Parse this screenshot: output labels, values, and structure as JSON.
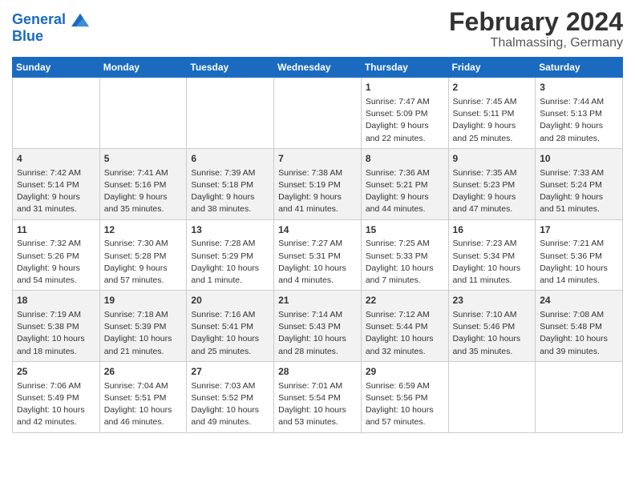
{
  "header": {
    "logo_line1": "General",
    "logo_line2": "Blue",
    "title": "February 2024",
    "subtitle": "Thalmassing, Germany"
  },
  "calendar": {
    "days_of_week": [
      "Sunday",
      "Monday",
      "Tuesday",
      "Wednesday",
      "Thursday",
      "Friday",
      "Saturday"
    ],
    "weeks": [
      [
        {
          "day": "",
          "info": ""
        },
        {
          "day": "",
          "info": ""
        },
        {
          "day": "",
          "info": ""
        },
        {
          "day": "",
          "info": ""
        },
        {
          "day": "1",
          "info": "Sunrise: 7:47 AM\nSunset: 5:09 PM\nDaylight: 9 hours\nand 22 minutes."
        },
        {
          "day": "2",
          "info": "Sunrise: 7:45 AM\nSunset: 5:11 PM\nDaylight: 9 hours\nand 25 minutes."
        },
        {
          "day": "3",
          "info": "Sunrise: 7:44 AM\nSunset: 5:13 PM\nDaylight: 9 hours\nand 28 minutes."
        }
      ],
      [
        {
          "day": "4",
          "info": "Sunrise: 7:42 AM\nSunset: 5:14 PM\nDaylight: 9 hours\nand 31 minutes."
        },
        {
          "day": "5",
          "info": "Sunrise: 7:41 AM\nSunset: 5:16 PM\nDaylight: 9 hours\nand 35 minutes."
        },
        {
          "day": "6",
          "info": "Sunrise: 7:39 AM\nSunset: 5:18 PM\nDaylight: 9 hours\nand 38 minutes."
        },
        {
          "day": "7",
          "info": "Sunrise: 7:38 AM\nSunset: 5:19 PM\nDaylight: 9 hours\nand 41 minutes."
        },
        {
          "day": "8",
          "info": "Sunrise: 7:36 AM\nSunset: 5:21 PM\nDaylight: 9 hours\nand 44 minutes."
        },
        {
          "day": "9",
          "info": "Sunrise: 7:35 AM\nSunset: 5:23 PM\nDaylight: 9 hours\nand 47 minutes."
        },
        {
          "day": "10",
          "info": "Sunrise: 7:33 AM\nSunset: 5:24 PM\nDaylight: 9 hours\nand 51 minutes."
        }
      ],
      [
        {
          "day": "11",
          "info": "Sunrise: 7:32 AM\nSunset: 5:26 PM\nDaylight: 9 hours\nand 54 minutes."
        },
        {
          "day": "12",
          "info": "Sunrise: 7:30 AM\nSunset: 5:28 PM\nDaylight: 9 hours\nand 57 minutes."
        },
        {
          "day": "13",
          "info": "Sunrise: 7:28 AM\nSunset: 5:29 PM\nDaylight: 10 hours\nand 1 minute."
        },
        {
          "day": "14",
          "info": "Sunrise: 7:27 AM\nSunset: 5:31 PM\nDaylight: 10 hours\nand 4 minutes."
        },
        {
          "day": "15",
          "info": "Sunrise: 7:25 AM\nSunset: 5:33 PM\nDaylight: 10 hours\nand 7 minutes."
        },
        {
          "day": "16",
          "info": "Sunrise: 7:23 AM\nSunset: 5:34 PM\nDaylight: 10 hours\nand 11 minutes."
        },
        {
          "day": "17",
          "info": "Sunrise: 7:21 AM\nSunset: 5:36 PM\nDaylight: 10 hours\nand 14 minutes."
        }
      ],
      [
        {
          "day": "18",
          "info": "Sunrise: 7:19 AM\nSunset: 5:38 PM\nDaylight: 10 hours\nand 18 minutes."
        },
        {
          "day": "19",
          "info": "Sunrise: 7:18 AM\nSunset: 5:39 PM\nDaylight: 10 hours\nand 21 minutes."
        },
        {
          "day": "20",
          "info": "Sunrise: 7:16 AM\nSunset: 5:41 PM\nDaylight: 10 hours\nand 25 minutes."
        },
        {
          "day": "21",
          "info": "Sunrise: 7:14 AM\nSunset: 5:43 PM\nDaylight: 10 hours\nand 28 minutes."
        },
        {
          "day": "22",
          "info": "Sunrise: 7:12 AM\nSunset: 5:44 PM\nDaylight: 10 hours\nand 32 minutes."
        },
        {
          "day": "23",
          "info": "Sunrise: 7:10 AM\nSunset: 5:46 PM\nDaylight: 10 hours\nand 35 minutes."
        },
        {
          "day": "24",
          "info": "Sunrise: 7:08 AM\nSunset: 5:48 PM\nDaylight: 10 hours\nand 39 minutes."
        }
      ],
      [
        {
          "day": "25",
          "info": "Sunrise: 7:06 AM\nSunset: 5:49 PM\nDaylight: 10 hours\nand 42 minutes."
        },
        {
          "day": "26",
          "info": "Sunrise: 7:04 AM\nSunset: 5:51 PM\nDaylight: 10 hours\nand 46 minutes."
        },
        {
          "day": "27",
          "info": "Sunrise: 7:03 AM\nSunset: 5:52 PM\nDaylight: 10 hours\nand 49 minutes."
        },
        {
          "day": "28",
          "info": "Sunrise: 7:01 AM\nSunset: 5:54 PM\nDaylight: 10 hours\nand 53 minutes."
        },
        {
          "day": "29",
          "info": "Sunrise: 6:59 AM\nSunset: 5:56 PM\nDaylight: 10 hours\nand 57 minutes."
        },
        {
          "day": "",
          "info": ""
        },
        {
          "day": "",
          "info": ""
        }
      ]
    ]
  }
}
